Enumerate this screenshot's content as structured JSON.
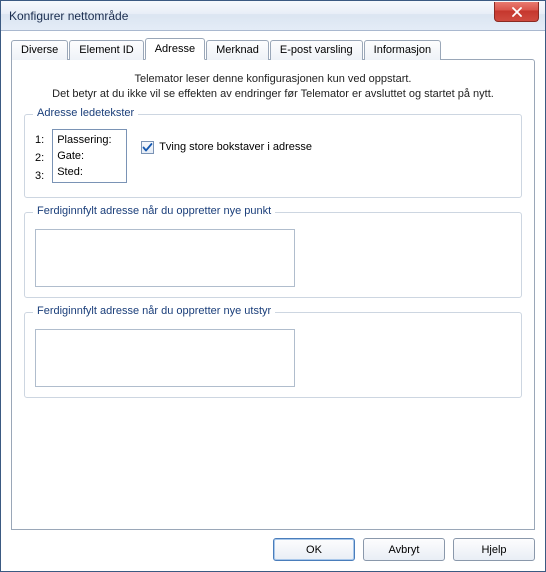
{
  "window": {
    "title": "Konfigurer nettområde"
  },
  "tabs": {
    "t0": "Diverse",
    "t1": "Element ID",
    "t2": "Adresse",
    "t3": "Merknad",
    "t4": "E-post varsling",
    "t5": "Informasjon"
  },
  "info": {
    "line1": "Telemator leser denne konfigurasjonen kun ved oppstart.",
    "line2": "Det betyr at du ikke vil se effekten av endringer før Telemator er avsluttet og startet på nytt."
  },
  "group_labels": {
    "legend": "Adresse ledetekster",
    "n1": "1:",
    "n2": "2:",
    "n3": "3:",
    "v1": "Plassering:",
    "v2": "Gate:",
    "v3": "Sted:",
    "checkbox": "Tving store bokstaver i adresse",
    "checked": true
  },
  "group_punkt": {
    "legend": "Ferdiginnfylt adresse når du oppretter nye punkt",
    "value": ""
  },
  "group_utstyr": {
    "legend": "Ferdiginnfylt adresse når du oppretter nye utstyr",
    "value": ""
  },
  "buttons": {
    "ok": "OK",
    "cancel": "Avbryt",
    "help": "Hjelp"
  }
}
